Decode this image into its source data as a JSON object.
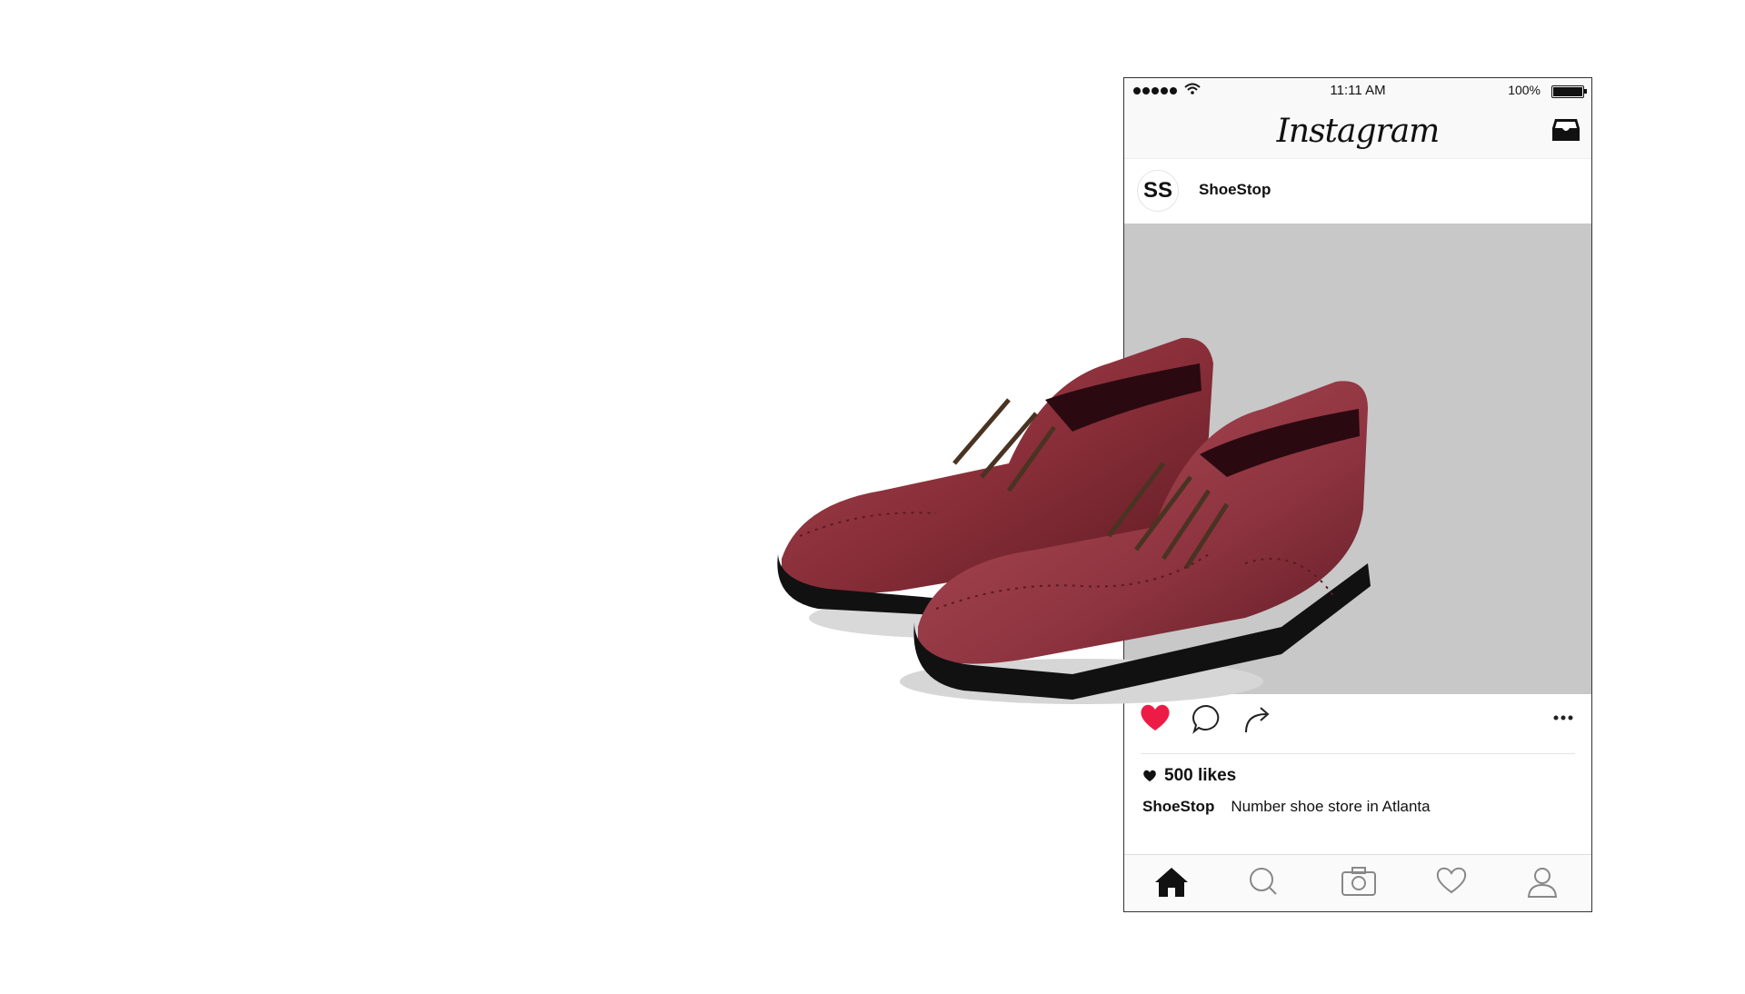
{
  "status_bar": {
    "time": "11:11 AM",
    "battery": "100%",
    "icons": [
      "signal-dots-icon",
      "wifi-icon",
      "battery-icon"
    ]
  },
  "nav": {
    "logo_text": "Instagram",
    "right_icon": "inbox-icon"
  },
  "post": {
    "avatar_text": "SS",
    "username": "ShoeStop",
    "image": "burgundy-brogue-shoes",
    "image_bg": "#c8c8c8",
    "liked": true,
    "like_color": "#ed1c46",
    "action_icons": [
      "heart-icon",
      "comment-icon",
      "share-icon",
      "more-icon"
    ],
    "likes": "500 likes",
    "caption_user": "ShoeStop",
    "caption_text": "Number shoe store in Atlanta"
  },
  "tab_bar": {
    "items": [
      "home-icon",
      "search-icon",
      "camera-icon",
      "activity-icon",
      "profile-icon"
    ]
  }
}
